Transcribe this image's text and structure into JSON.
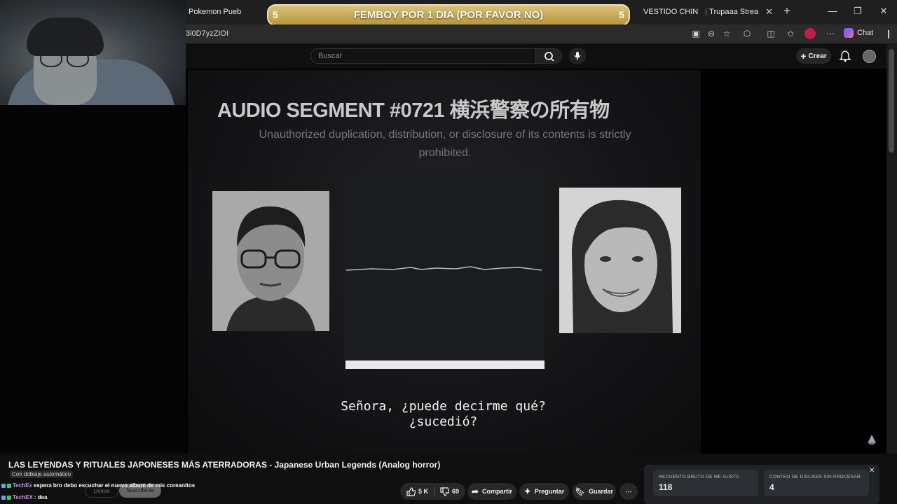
{
  "browser": {
    "tabs": [
      {
        "label": "Pokemon Pueb"
      },
      {
        "label": "VESTIDO CHIN"
      },
      {
        "label": "Trupaaa Strea"
      }
    ],
    "url_fragment": "3i0D7yzZIOI",
    "chat_label": "Chat"
  },
  "stream_banner": {
    "text": "FEMBOY POR 1 DIA (POR FAVOR NO)",
    "left_count": "5",
    "right_count": "5"
  },
  "youtube": {
    "search_placeholder": "Buscar",
    "create_label": "Crear"
  },
  "video_frame": {
    "segment_title": "AUDIO SEGMENT #0721  横浜警察の所有物",
    "warning_text": "Unauthorized duplication, distribution, or disclosure of its contents is strictly prohibited.",
    "subtitle": "Señora, ¿puede decirme qué?\n¿sucedió?"
  },
  "video_info": {
    "title": "LAS LEYENDAS Y RITUALES JAPONESES MÁS ATERRADORAS - Japanese Urban Legends (Analog horror)",
    "dubbing": "Con doblaje automático",
    "join_label": "Unirse",
    "subscribe_label": "Suscribirse",
    "likes": "5 K",
    "dislikes": "69",
    "share_label": "Compartir",
    "ask_label": "Preguntar",
    "save_label": "Guardar"
  },
  "chat": [
    {
      "user": "TechEx",
      "message": "espera bro debo escuchar el nuevo album de mis coreanitos"
    },
    {
      "user": "TechEX",
      "message": ": dea"
    }
  ],
  "dislike_panel": {
    "likes_label": "RECUENTO BRUTO DE ME GUSTA",
    "likes_value": "118",
    "dislikes_label": "CONTEO DE DISLIKES SIN PROCESAR",
    "dislikes_value": "4"
  }
}
